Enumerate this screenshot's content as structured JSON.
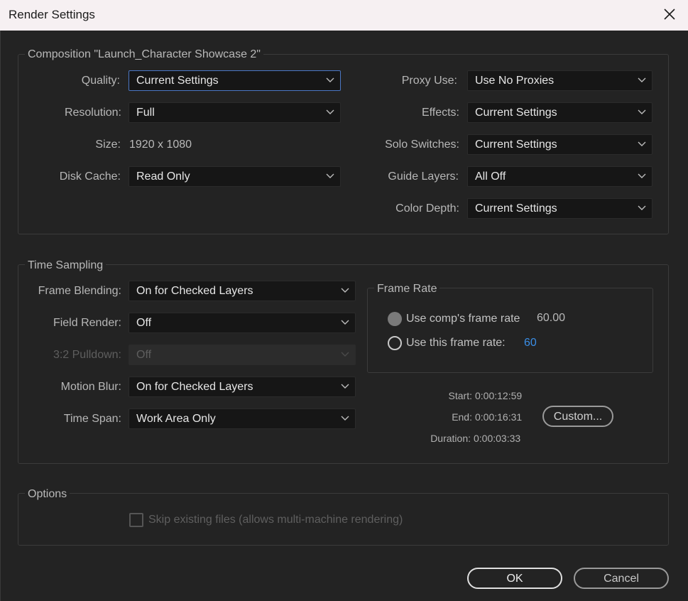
{
  "window": {
    "title": "Render Settings"
  },
  "composition": {
    "group_title": "Composition \"Launch_Character Showcase 2\"",
    "quality": {
      "label": "Quality:",
      "value": "Current Settings"
    },
    "resolution": {
      "label": "Resolution:",
      "value": "Full"
    },
    "size": {
      "label": "Size:",
      "value": "1920 x 1080"
    },
    "disk_cache": {
      "label": "Disk Cache:",
      "value": "Read Only"
    },
    "proxy_use": {
      "label": "Proxy Use:",
      "value": "Use No Proxies"
    },
    "effects": {
      "label": "Effects:",
      "value": "Current Settings"
    },
    "solo_switches": {
      "label": "Solo Switches:",
      "value": "Current Settings"
    },
    "guide_layers": {
      "label": "Guide Layers:",
      "value": "All Off"
    },
    "color_depth": {
      "label": "Color Depth:",
      "value": "Current Settings"
    }
  },
  "time_sampling": {
    "group_title": "Time Sampling",
    "frame_blending": {
      "label": "Frame Blending:",
      "value": "On for Checked Layers"
    },
    "field_render": {
      "label": "Field Render:",
      "value": "Off"
    },
    "pulldown": {
      "label": "3:2 Pulldown:",
      "value": "Off",
      "disabled": true
    },
    "motion_blur": {
      "label": "Motion Blur:",
      "value": "On for Checked Layers"
    },
    "time_span": {
      "label": "Time Span:",
      "value": "Work Area Only"
    },
    "frame_rate": {
      "group_title": "Frame Rate",
      "use_comp_label": "Use comp's frame rate",
      "use_comp_value": "60.00",
      "use_this_label": "Use this frame rate:",
      "use_this_value": "60",
      "selected": "use_comp"
    },
    "start": {
      "label": "Start:",
      "value": "0:00:12:59"
    },
    "end": {
      "label": "End:",
      "value": "0:00:16:31"
    },
    "duration": {
      "label": "Duration:",
      "value": "0:00:03:33"
    },
    "custom_button": "Custom..."
  },
  "options": {
    "group_title": "Options",
    "skip_existing": {
      "label": "Skip existing files (allows multi-machine rendering)",
      "checked": false,
      "disabled": true
    }
  },
  "buttons": {
    "ok": "OK",
    "cancel": "Cancel"
  },
  "colors": {
    "accent_focus": "#4b77c4",
    "link_value": "#3a8ee6",
    "dialog_bg": "#232323",
    "field_bg": "#161616"
  }
}
